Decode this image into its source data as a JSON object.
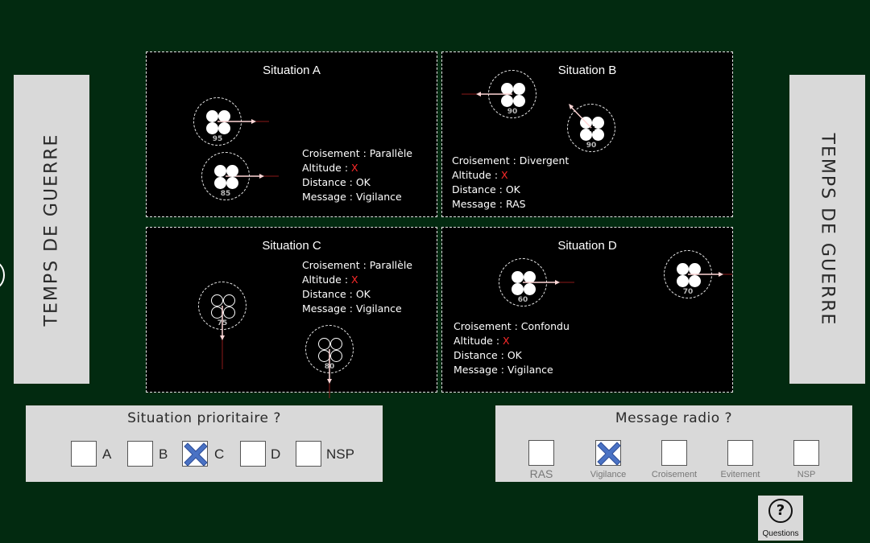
{
  "side_label": "TEMPS DE GUERRE",
  "situations": {
    "a": {
      "title": "Situation A",
      "croisement": "Croisement : Parallèle",
      "altitude_prefix": "Altitude : ",
      "altitude_value": "X",
      "distance": "Distance : OK",
      "message": "Message : Vigilance",
      "levels": [
        "95",
        "85"
      ]
    },
    "b": {
      "title": "Situation B",
      "croisement": "Croisement : Divergent",
      "altitude_prefix": "Altitude : ",
      "altitude_value": "X",
      "distance": "Distance : OK",
      "message": "Message : RAS",
      "levels": [
        "90",
        "90"
      ]
    },
    "c": {
      "title": "Situation C",
      "croisement": "Croisement : Parallèle",
      "altitude_prefix": "Altitude : ",
      "altitude_value": "X",
      "distance": "Distance : OK",
      "message": "Message : Vigilance",
      "levels": [
        "75",
        "80"
      ]
    },
    "d": {
      "title": "Situation D",
      "croisement": "Croisement : Confondu",
      "altitude_prefix": "Altitude : ",
      "altitude_value": "X",
      "distance": "Distance : OK",
      "message": "Message : Vigilance",
      "levels": [
        "60",
        "70"
      ]
    }
  },
  "priority_panel": {
    "title": "Situation prioritaire ?",
    "options": [
      "A",
      "B",
      "C",
      "D",
      "NSP"
    ],
    "checked": "C"
  },
  "radio_panel": {
    "title": "Message radio ?",
    "options": [
      "RAS",
      "Vigilance",
      "Croisement",
      "Evitement",
      "NSP"
    ],
    "checked": "Vigilance"
  },
  "questions_button": {
    "label": "Questions",
    "icon": "?"
  },
  "colors": {
    "background": "#022a10",
    "panel": "#d9d9d9",
    "alert": "#ff2a2a",
    "check_mark": "#4a72c4"
  }
}
